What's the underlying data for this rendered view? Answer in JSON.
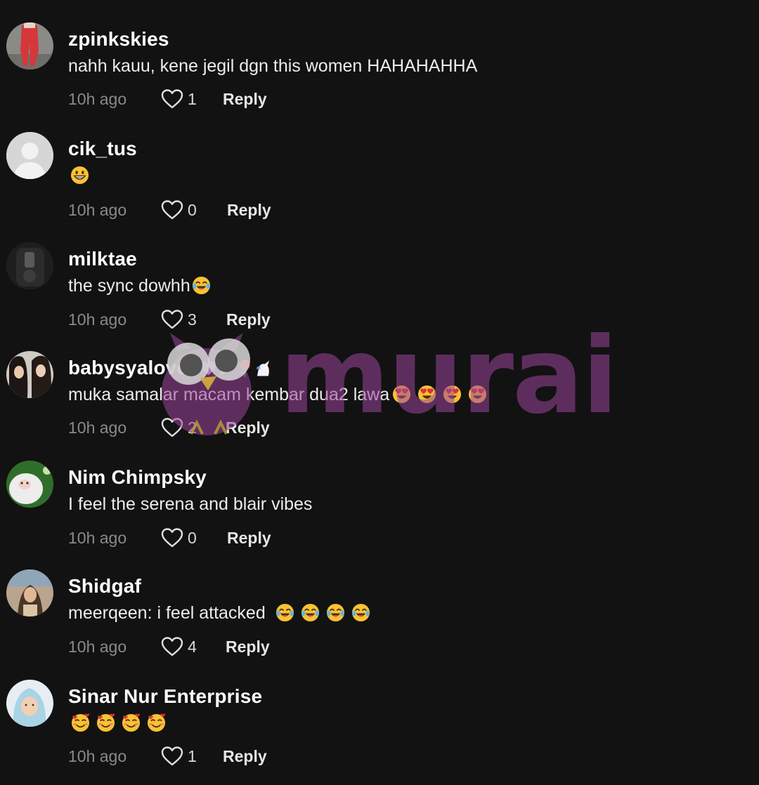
{
  "comments": [
    {
      "username": "zpinkskies",
      "text": "nahh kauu, kene jegil dgn this women HAHAHAHHA",
      "emojis": [],
      "time": "10h ago",
      "likes": "1",
      "reply_label": "Reply",
      "avatar": "avatar-red-pants-photo"
    },
    {
      "username": "cik_tus",
      "text": "",
      "emojis": [
        "grinning-face-emoji"
      ],
      "time": "10h ago",
      "likes": "0",
      "reply_label": "Reply",
      "avatar": "avatar-default-person"
    },
    {
      "username": "milktae",
      "text": "the sync dowhh",
      "emojis": [
        "tears-of-joy-emoji"
      ],
      "time": "10h ago",
      "likes": "3",
      "reply_label": "Reply",
      "avatar": "avatar-mirror-selfie-photo"
    },
    {
      "username": "babysyalove",
      "username_suffix_emojis": [
        "hearts-emoji",
        "pencil-emoji",
        "rose-emoji",
        "unicorn-emoji"
      ],
      "text": "muka samalar macam kembar dua2 lawa",
      "emojis": [
        "heart-eyes-emoji",
        "heart-eyes-emoji",
        "heart-eyes-emoji",
        "heart-eyes-emoji"
      ],
      "time": "10h ago",
      "likes": "2",
      "reply_label": "Reply",
      "avatar": "avatar-two-girls-photo"
    },
    {
      "username": "Nim Chimpsky",
      "text": "I feel the serena and blair vibes",
      "emojis": [],
      "time": "10h ago",
      "likes": "0",
      "reply_label": "Reply",
      "avatar": "avatar-white-monkey-photo"
    },
    {
      "username": "Shidgaf",
      "text": "meerqeen: i feel attacked",
      "emojis": [
        "tears-of-joy-emoji",
        "tears-of-joy-emoji",
        "tears-of-joy-emoji",
        "tears-of-joy-emoji"
      ],
      "time": "10h ago",
      "likes": "4",
      "reply_label": "Reply",
      "avatar": "avatar-girl-outdoor-photo"
    },
    {
      "username": "Sinar Nur Enterprise",
      "text": "",
      "emojis": [
        "smiling-hearts-emoji",
        "smiling-hearts-emoji",
        "smiling-hearts-emoji",
        "smiling-hearts-emoji"
      ],
      "time": "10h ago",
      "likes": "1",
      "reply_label": "Reply",
      "avatar": "avatar-hijab-woman-photo"
    }
  ],
  "watermark": {
    "brand": "murai",
    "icon": "owl-logo-icon"
  },
  "colors": {
    "background": "#121212",
    "text": "#ffffff",
    "muted": "#8a8a8a",
    "watermark": "#9b469b"
  }
}
